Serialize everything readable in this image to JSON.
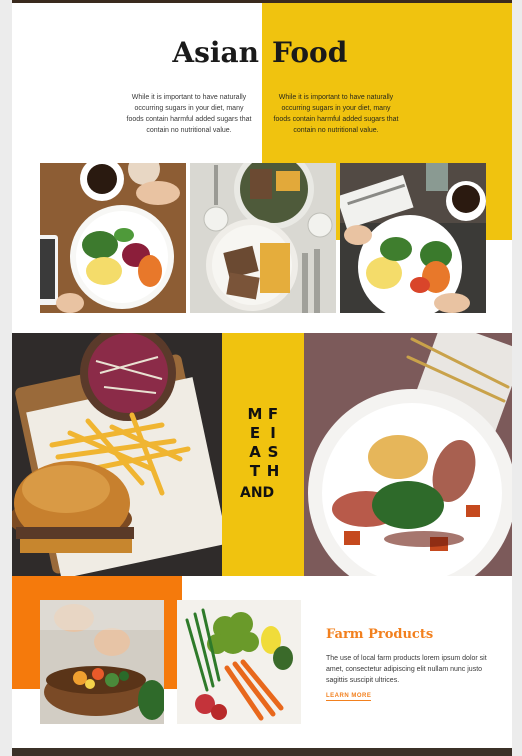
{
  "hero": {
    "title_left": "Asian",
    "title_right": "Food",
    "intro_left": "While it is important to have naturally occurring sugars in your diet, many foods contain harmful added sugars that contain no nutritional value.",
    "intro_right": "While it is important to have naturally occurring sugars in your diet, many foods contain harmful added sugars that contain no nutritional value."
  },
  "gallery": {
    "photos": [
      "breakfast-plate-photo",
      "sandwich-fries-photo",
      "breakfast-plate-photo-2"
    ]
  },
  "feature": {
    "col1": [
      "M",
      "E",
      "A",
      "T"
    ],
    "col2": [
      "F",
      "I",
      "S",
      "H"
    ],
    "and_word": "AND"
  },
  "farm": {
    "title": "Farm Products",
    "text": "The use of local farm products lorem ipsum dolor sit amet, consectetur adipiscing elit nullam nunc justo sagittis suscipit ultrices.",
    "link_label": "LEARN MORE"
  },
  "colors": {
    "yellow": "#f0c30f",
    "orange": "#f57a0c",
    "accent_text": "#f2801e"
  }
}
